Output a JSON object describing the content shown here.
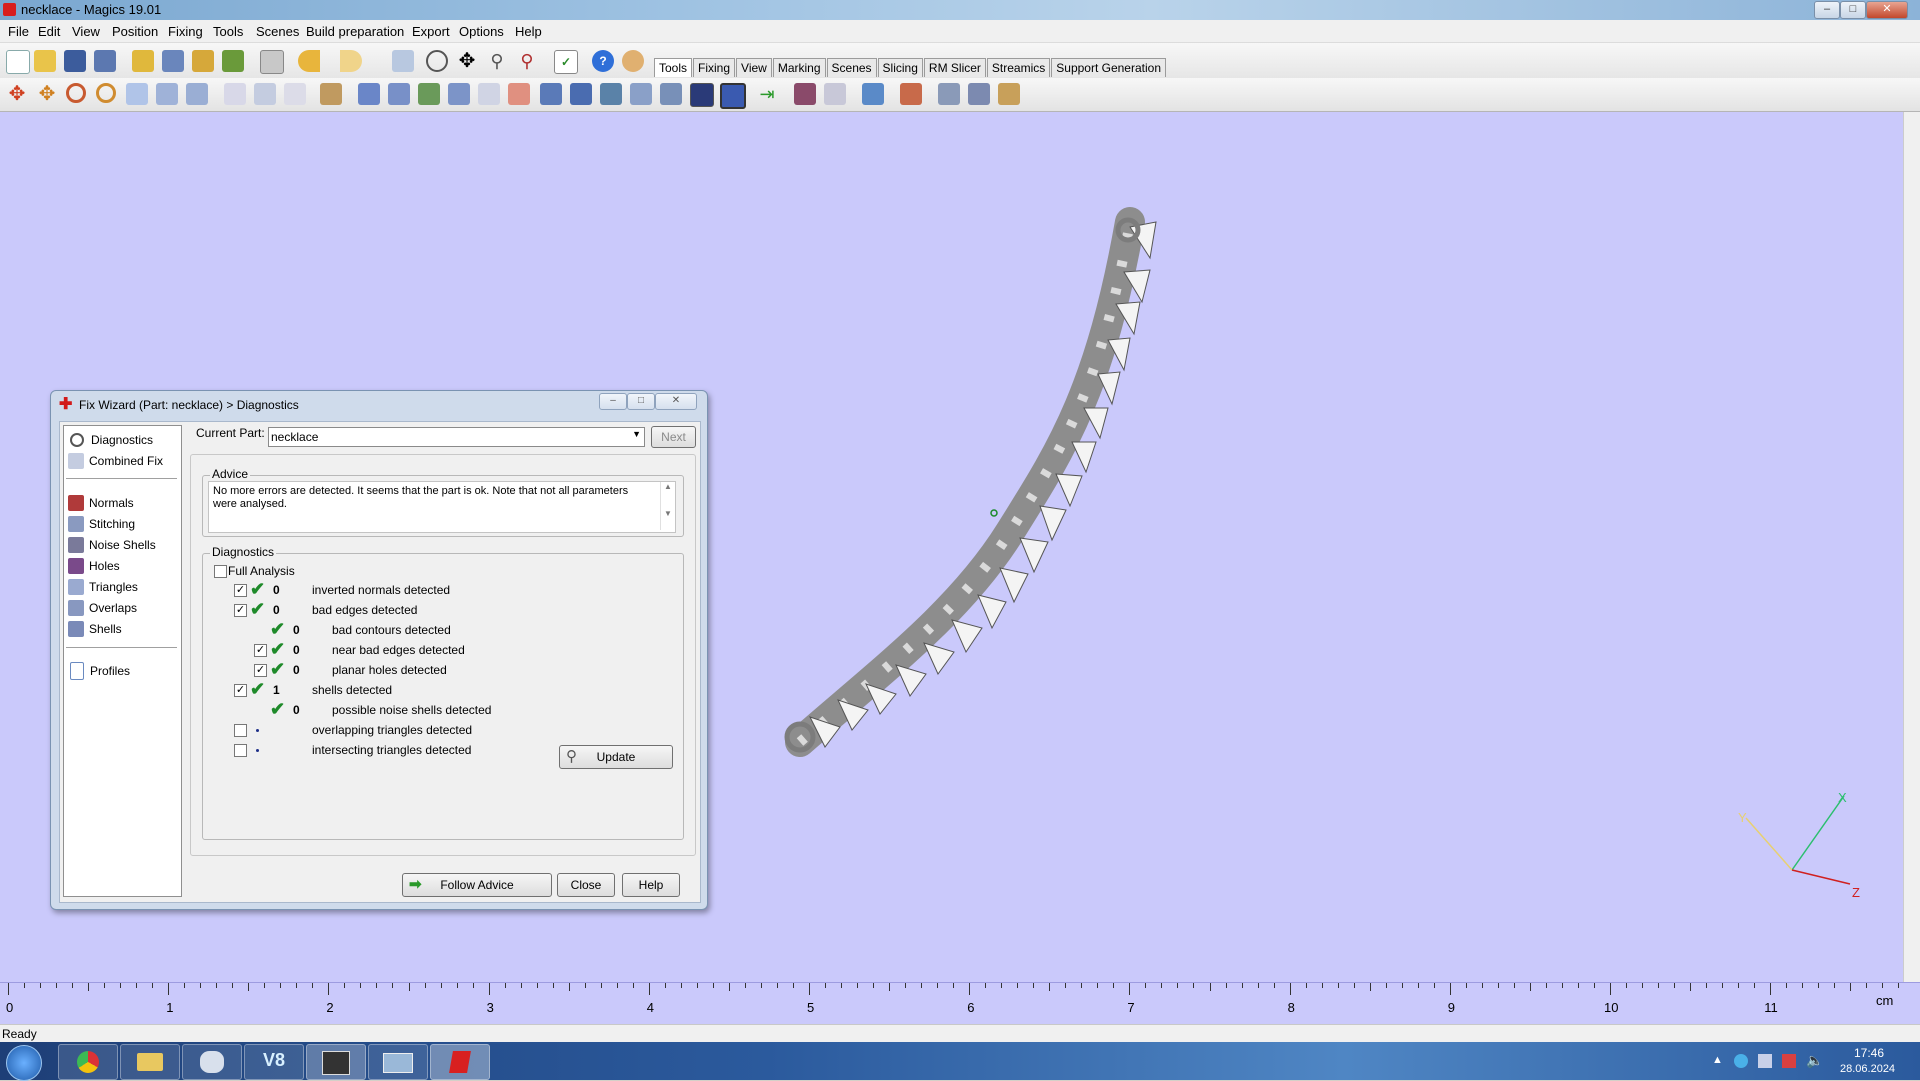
{
  "window": {
    "title": "necklace - Magics 19.01",
    "controls": {
      "minimize": "–",
      "maximize": "□",
      "close": "✕"
    }
  },
  "menu": [
    "File",
    "Edit",
    "View",
    "Position",
    "Fixing",
    "Tools",
    "Scenes",
    "Build preparation",
    "Export",
    "Options",
    "Help"
  ],
  "toolbar_tabs": [
    "Tools",
    "Fixing",
    "View",
    "Marking",
    "Scenes",
    "Slicing",
    "RM Slicer",
    "Streamics",
    "Support Generation"
  ],
  "active_tab": "Tools",
  "dialog": {
    "title": "Fix Wizard (Part: necklace) > Diagnostics",
    "nav_top": [
      {
        "label": "Diagnostics",
        "icon": "magnifier-icon"
      },
      {
        "label": "Combined Fix",
        "icon": "cube-icon"
      }
    ],
    "nav_tools": [
      {
        "label": "Normals",
        "icon": "normals-icon"
      },
      {
        "label": "Stitching",
        "icon": "stitching-icon"
      },
      {
        "label": "Noise Shells",
        "icon": "noise-shells-icon"
      },
      {
        "label": "Holes",
        "icon": "holes-icon"
      },
      {
        "label": "Triangles",
        "icon": "triangles-icon"
      },
      {
        "label": "Overlaps",
        "icon": "overlaps-icon"
      },
      {
        "label": "Shells",
        "icon": "shells-icon"
      }
    ],
    "nav_bottom": [
      {
        "label": "Profiles",
        "icon": "document-icon"
      }
    ],
    "current_part_label": "Current Part:",
    "current_part_value": "necklace",
    "next_label": "Next",
    "advice_title": "Advice",
    "advice_text": "No more errors are detected. It seems that the part is ok. Note that not all parameters were analysed.",
    "diagnostics_title": "Diagnostics",
    "full_analysis_label": "Full Analysis",
    "rows": [
      {
        "checked": true,
        "status": "ok",
        "count": "0",
        "label": "inverted normals detected",
        "indent": 0
      },
      {
        "checked": true,
        "status": "ok",
        "count": "0",
        "label": "bad edges detected",
        "indent": 0
      },
      {
        "checked": null,
        "status": "ok",
        "count": "0",
        "label": "bad contours detected",
        "indent": 1
      },
      {
        "checked": true,
        "status": "ok",
        "count": "0",
        "label": "near bad edges detected",
        "indent": 1
      },
      {
        "checked": true,
        "status": "ok",
        "count": "0",
        "label": "planar holes detected",
        "indent": 1
      },
      {
        "checked": true,
        "status": "ok",
        "count": "1",
        "label": "shells detected",
        "indent": 0
      },
      {
        "checked": null,
        "status": "ok",
        "count": "0",
        "label": "possible noise shells detected",
        "indent": 1
      },
      {
        "checked": false,
        "status": "unknown",
        "count": "",
        "label": "overlapping triangles detected",
        "indent": 0
      },
      {
        "checked": false,
        "status": "unknown",
        "count": "",
        "label": "intersecting triangles detected",
        "indent": 0
      }
    ],
    "update_label": "Update",
    "follow_advice_label": "Follow Advice",
    "close_label": "Close",
    "help_label": "Help"
  },
  "ruler": {
    "labels": [
      "0",
      "1",
      "2",
      "3",
      "4",
      "5",
      "6",
      "7",
      "8",
      "9",
      "10",
      "11"
    ],
    "unit": "cm"
  },
  "axes": {
    "x": "X",
    "y": "Y",
    "z": "Z"
  },
  "status": "Ready",
  "clock": {
    "time": "17:46",
    "date": "28.06.2024"
  },
  "colors": {
    "viewport": "#cac9fb",
    "ok_check": "#1f8a2a",
    "axis_x": "#2bbf6e",
    "axis_z": "#d02020",
    "axis_y": "#e8d070"
  }
}
